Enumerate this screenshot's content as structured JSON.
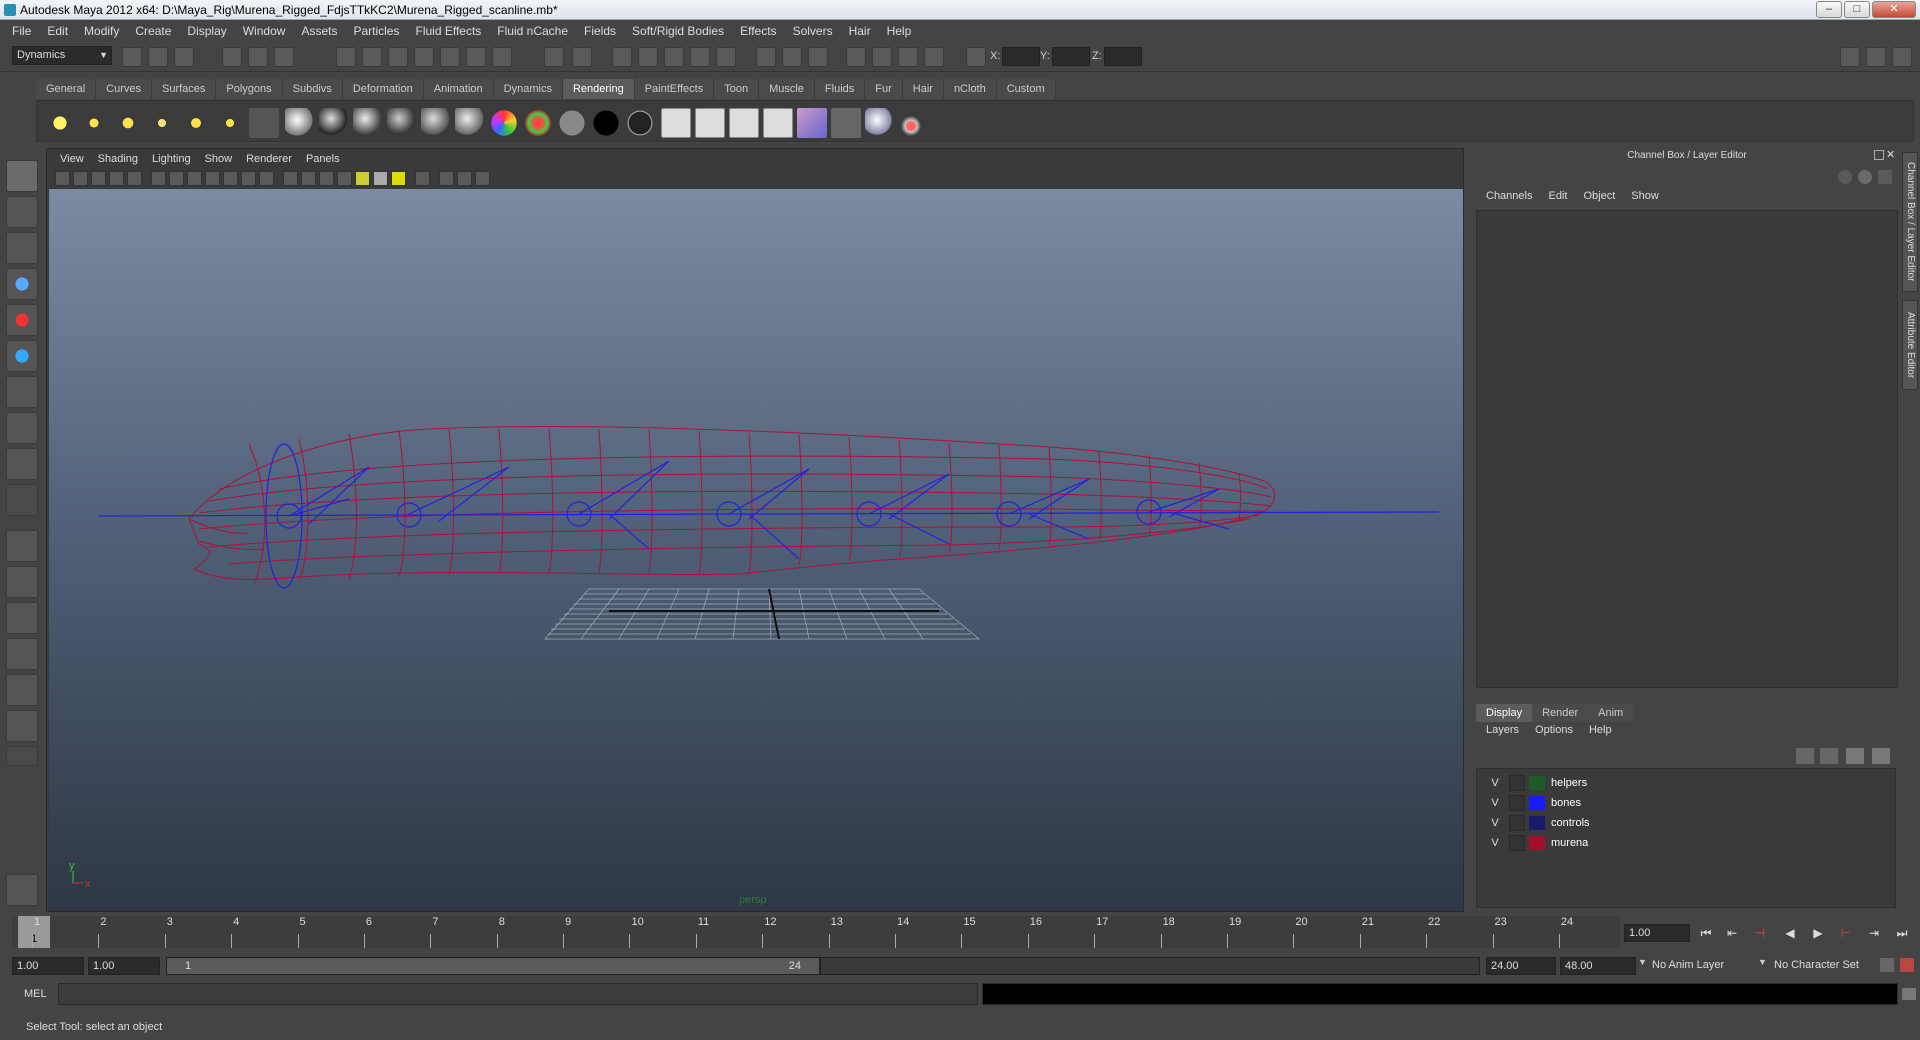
{
  "window": {
    "title": "Autodesk Maya 2012 x64: D:\\Maya_Rig\\Murena_Rigged_FdjsTTkKC2\\Murena_Rigged_scanline.mb*",
    "min": "–",
    "max": "□",
    "close": "✕"
  },
  "menubar": [
    "File",
    "Edit",
    "Modify",
    "Create",
    "Display",
    "Window",
    "Assets",
    "Particles",
    "Fluid Effects",
    "Fluid nCache",
    "Fields",
    "Soft/Rigid Bodies",
    "Effects",
    "Solvers",
    "Hair",
    "Help"
  ],
  "statusline": {
    "menuset": "Dynamics",
    "x_label": "X:",
    "y_label": "Y:",
    "z_label": "Z:"
  },
  "shelf": {
    "tabs": [
      "General",
      "Curves",
      "Surfaces",
      "Polygons",
      "Subdivs",
      "Deformation",
      "Animation",
      "Dynamics",
      "Rendering",
      "PaintEffects",
      "Toon",
      "Muscle",
      "Fluids",
      "Fur",
      "Hair",
      "nCloth",
      "Custom"
    ],
    "active_tab": "Rendering"
  },
  "viewport": {
    "menus": [
      "View",
      "Shading",
      "Lighting",
      "Show",
      "Renderer",
      "Panels"
    ],
    "camera_label": "persp",
    "axis_y": "y",
    "axis_x": "x"
  },
  "channel_box": {
    "title": "Channel Box / Layer Editor",
    "menus": [
      "Channels",
      "Edit",
      "Object",
      "Show"
    ],
    "side_tabs": [
      "Channel Box / Layer Editor",
      "Attribute Editor"
    ]
  },
  "layer_editor": {
    "tabs": [
      "Display",
      "Render",
      "Anim"
    ],
    "active_tab": "Display",
    "menus": [
      "Layers",
      "Options",
      "Help"
    ],
    "layers": [
      {
        "visible": "V",
        "name": "helpers",
        "color": "#1f5a2a"
      },
      {
        "visible": "V",
        "name": "bones",
        "color": "#1a1aff"
      },
      {
        "visible": "V",
        "name": "controls",
        "color": "#1a1a6a"
      },
      {
        "visible": "V",
        "name": "murena",
        "color": "#a0102a"
      }
    ]
  },
  "time_slider": {
    "frames": [
      "1",
      "2",
      "3",
      "4",
      "5",
      "6",
      "7",
      "8",
      "9",
      "10",
      "11",
      "12",
      "13",
      "14",
      "15",
      "16",
      "17",
      "18",
      "19",
      "20",
      "21",
      "22",
      "23",
      "24"
    ],
    "current_frame": "1",
    "current_time": "1.00"
  },
  "playback": {
    "go_start": "⏮",
    "step_back": "⇤",
    "key_back": "⊣",
    "play_back": "◀",
    "play_fwd": "▶",
    "key_fwd": "⊢",
    "step_fwd": "⇥",
    "go_end": "⏭"
  },
  "range": {
    "start": "1.00",
    "inner_start": "1.00",
    "range_min": "1",
    "range_max": "24",
    "inner_end": "24.00",
    "end": "48.00",
    "anim_layer": "No Anim Layer",
    "character_set": "No Character Set"
  },
  "command_line": {
    "label": "MEL"
  },
  "help_line": {
    "text": "Select Tool: select an object"
  }
}
